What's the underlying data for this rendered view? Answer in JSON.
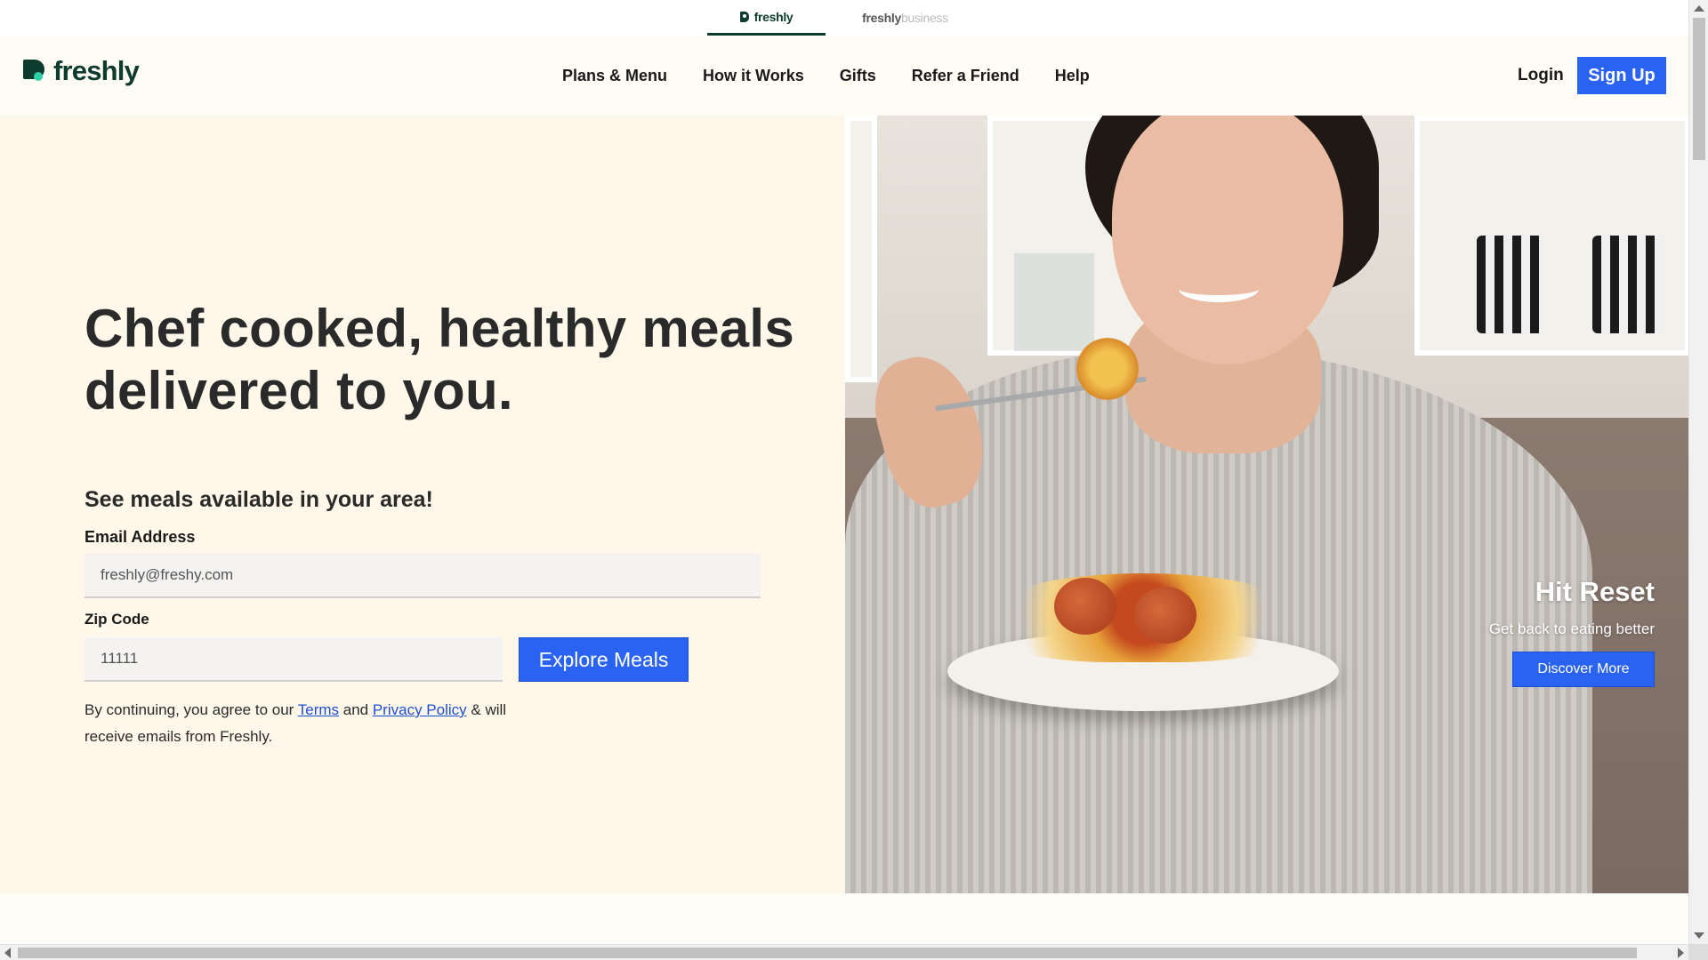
{
  "brand_switcher": {
    "active_tab": "freshly",
    "inactive_tab_brand": "freshly",
    "inactive_tab_suffix": "business"
  },
  "header": {
    "logo_text": "freshly",
    "nav": [
      "Plans & Menu",
      "How it Works",
      "Gifts",
      "Refer a Friend",
      "Help"
    ],
    "login_label": "Login",
    "signup_label": "Sign Up"
  },
  "hero": {
    "headline": "Chef cooked, healthy meals delivered to you.",
    "subhead": "See meals available in your area!",
    "email_label": "Email Address",
    "email_value": "freshly@freshy.com",
    "zip_label": "Zip Code",
    "zip_value": "11111",
    "explore_button": "Explore Meals",
    "terms_prefix": "By continuing, you agree to our ",
    "terms_link": "Terms",
    "terms_and": " and ",
    "privacy_link": "Privacy Policy",
    "terms_suffix": " & will receive emails from Freshly."
  },
  "promo": {
    "title": "Hit Reset",
    "subtitle": "Get back to eating better",
    "button": "Discover More"
  },
  "colors": {
    "brand_green": "#0d3b2e",
    "accent_mint": "#2fcfa8",
    "cta_blue": "#2a63f2",
    "hero_cream": "#fff7e9"
  }
}
